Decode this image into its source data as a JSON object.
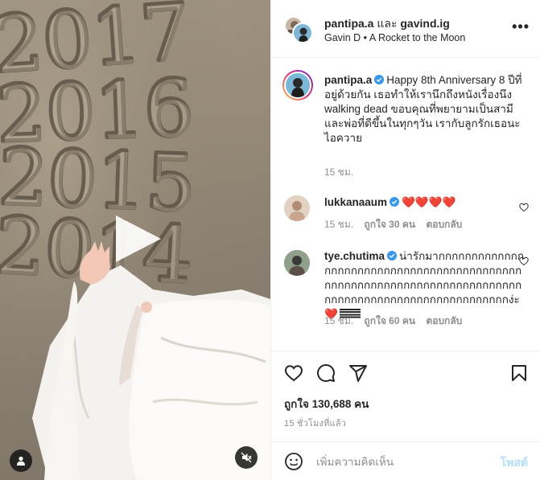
{
  "media": {
    "sand_text": [
      "2017",
      "2016",
      "2015",
      "2014"
    ],
    "icons": {
      "play": "play-icon",
      "user_tag": "user-tag-icon",
      "mute": "mute-icon"
    }
  },
  "header": {
    "user1": "pantipa.a",
    "and": "และ",
    "user2": "gavind.ig",
    "audio_artist": "Gavin D",
    "audio_sep": "•",
    "audio_title": "A Rocket to the Moon",
    "more": "•••"
  },
  "caption": {
    "username": "pantipa.a",
    "text": "Happy 8th Anniversary 8 ปีที่อยู่ด้วยกัน เธอทำให้เรานึกถึงหนังเรื่องนึง walking dead ขอบคุณที่พยายามเป็นสามีและพ่อที่ดีขึ้นในทุกๆวัน เรากับลูกรักเธอนะ ไอควาย",
    "time": "15 ชม."
  },
  "comments": [
    {
      "username": "lukkanaaum",
      "text": "❤️❤️❤️❤️",
      "time": "15 ชม.",
      "likes": "ถูกใจ 30 คน",
      "reply": "ตอบกลับ"
    },
    {
      "username": "tye.chutima",
      "text": "น่ารักมากกกกกกกกกกกกกกกกกกกกกกกกกกกกกกกกกกกกกกกกกกกกกกกกกกกกกกกกกกกกกกกกกกกกกกกกกกกกกกกกกกกกกกกกก",
      "tail": "กกกกกกกกกกกก",
      "ending": "ง่ะ",
      "heart": "❤️",
      "time": "15 ชม.",
      "likes": "ถูกใจ 60 คน",
      "reply": "ตอบกลับ"
    }
  ],
  "actions": {
    "likes": "ถูกใจ 130,688 คน",
    "time_ago": "15 ชั่วโมงที่แล้ว"
  },
  "composer": {
    "placeholder": "เพิ่มความคิดเห็น",
    "post": "โพสต์"
  },
  "colors": {
    "verified": "#3897f0",
    "link_disabled": "#b2dffc",
    "secondary": "#8e8e8e"
  }
}
